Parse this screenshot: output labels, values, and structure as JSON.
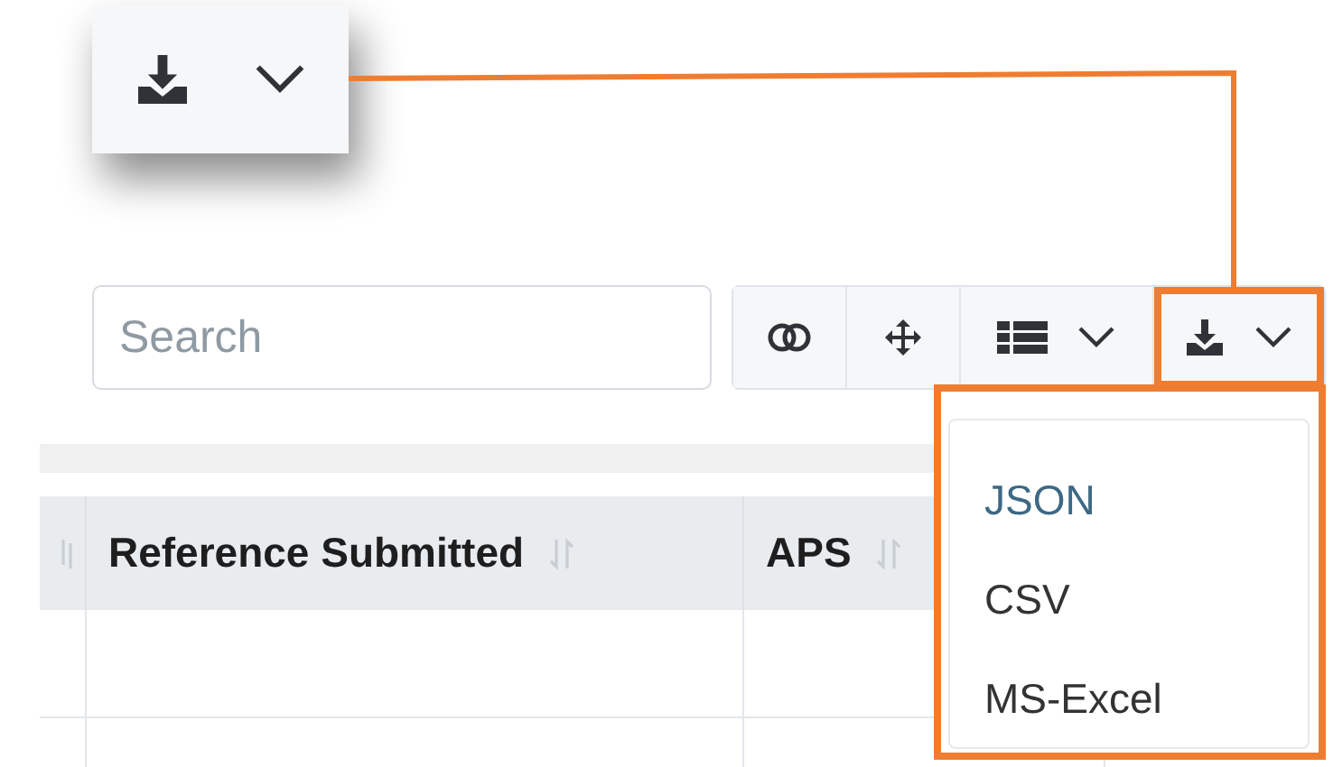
{
  "search": {
    "placeholder": "Search"
  },
  "toolbar": [
    {
      "kind": "toggle"
    },
    {
      "kind": "move"
    },
    {
      "kind": "columns"
    },
    {
      "kind": "export"
    }
  ],
  "table": {
    "columns": [
      {
        "label": "Reference Submitted"
      },
      {
        "label": "APS"
      }
    ]
  },
  "export_menu": {
    "items": [
      {
        "label": "JSON",
        "selected": true
      },
      {
        "label": "CSV",
        "selected": false
      },
      {
        "label": "MS-Excel",
        "selected": false
      }
    ]
  }
}
